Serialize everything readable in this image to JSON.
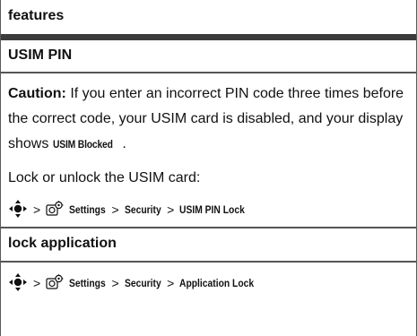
{
  "section_header": "features",
  "usim": {
    "title": "USIM PIN",
    "caution_label": "Caution:",
    "caution_text_1": " If you enter an incorrect PIN code three times before the correct code, your USIM card is disabled, and your display shows ",
    "caution_term": "USIM Blocked",
    "caution_text_2": ".",
    "instruction": "Lock or unlock the USIM card:",
    "path": {
      "separator": ">",
      "items": [
        "Settings",
        "Security",
        "USIM PIN Lock"
      ]
    }
  },
  "lock_app": {
    "title": "lock application",
    "path": {
      "separator": ">",
      "items": [
        "Settings",
        "Security",
        "Application Lock"
      ]
    }
  },
  "icons": {
    "nav_key": "nav-key-icon",
    "settings": "settings-icon"
  }
}
